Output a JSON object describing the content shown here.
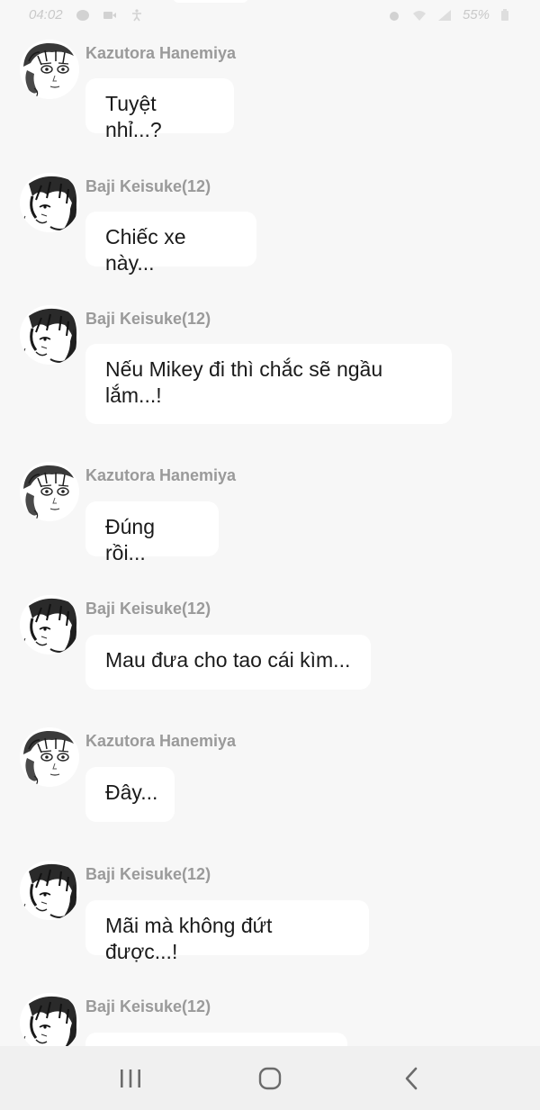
{
  "status_bar": {
    "time": "04:02",
    "battery": "55%",
    "icons": [
      "messenger-icon",
      "video-icon",
      "accessibility-icon",
      "alarm-icon",
      "wifi-icon",
      "signal-icon",
      "battery-icon"
    ]
  },
  "messages": [
    {
      "sender": "Kazutora Hanemiya",
      "text": "Tuyệt nhỉ...?",
      "avatar": "kazutora-avatar"
    },
    {
      "sender": "Baji Keisuke(12)",
      "text": "Chiếc xe này...",
      "avatar": "baji-avatar"
    },
    {
      "sender": "Baji Keisuke(12)",
      "text": "Nếu Mikey đi thì chắc sẽ ngầu lắm...!",
      "avatar": "baji-avatar"
    },
    {
      "sender": "Kazutora Hanemiya",
      "text": "Đúng rồi...",
      "avatar": "kazutora-avatar"
    },
    {
      "sender": "Baji Keisuke(12)",
      "text": "Mau đưa cho tao cái kìm...",
      "avatar": "baji-avatar"
    },
    {
      "sender": "Kazutora Hanemiya",
      "text": "Đây...",
      "avatar": "kazutora-avatar"
    },
    {
      "sender": "Baji Keisuke(12)",
      "text": "Mãi mà không đứt được...!",
      "avatar": "baji-avatar"
    },
    {
      "sender": "Baji Keisuke(12)",
      "text": "",
      "avatar": "baji-avatar"
    }
  ],
  "navbar": {
    "buttons": [
      "recent-apps-icon",
      "home-icon",
      "back-icon"
    ]
  },
  "colors": {
    "background": "#f7f7f7",
    "bubble": "#ffffff",
    "sender_name": "#9a9a9a",
    "message_text": "#1a1a1a",
    "navbar": "#f0f0f0"
  }
}
